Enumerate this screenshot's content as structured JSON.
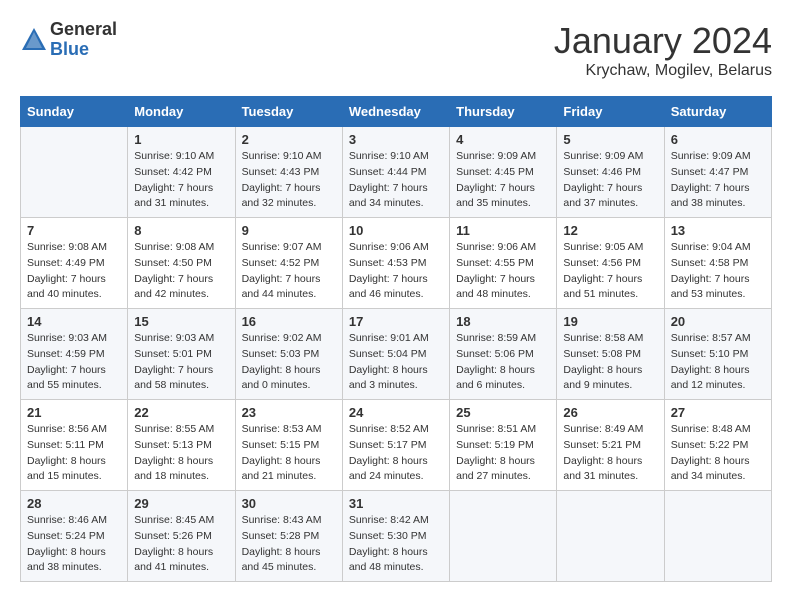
{
  "header": {
    "logo_general": "General",
    "logo_blue": "Blue",
    "title": "January 2024",
    "subtitle": "Krychaw, Mogilev, Belarus"
  },
  "calendar": {
    "days_of_week": [
      "Sunday",
      "Monday",
      "Tuesday",
      "Wednesday",
      "Thursday",
      "Friday",
      "Saturday"
    ],
    "weeks": [
      [
        {
          "day": "",
          "info": ""
        },
        {
          "day": "1",
          "info": "Sunrise: 9:10 AM\nSunset: 4:42 PM\nDaylight: 7 hours\nand 31 minutes."
        },
        {
          "day": "2",
          "info": "Sunrise: 9:10 AM\nSunset: 4:43 PM\nDaylight: 7 hours\nand 32 minutes."
        },
        {
          "day": "3",
          "info": "Sunrise: 9:10 AM\nSunset: 4:44 PM\nDaylight: 7 hours\nand 34 minutes."
        },
        {
          "day": "4",
          "info": "Sunrise: 9:09 AM\nSunset: 4:45 PM\nDaylight: 7 hours\nand 35 minutes."
        },
        {
          "day": "5",
          "info": "Sunrise: 9:09 AM\nSunset: 4:46 PM\nDaylight: 7 hours\nand 37 minutes."
        },
        {
          "day": "6",
          "info": "Sunrise: 9:09 AM\nSunset: 4:47 PM\nDaylight: 7 hours\nand 38 minutes."
        }
      ],
      [
        {
          "day": "7",
          "info": "Sunrise: 9:08 AM\nSunset: 4:49 PM\nDaylight: 7 hours\nand 40 minutes."
        },
        {
          "day": "8",
          "info": "Sunrise: 9:08 AM\nSunset: 4:50 PM\nDaylight: 7 hours\nand 42 minutes."
        },
        {
          "day": "9",
          "info": "Sunrise: 9:07 AM\nSunset: 4:52 PM\nDaylight: 7 hours\nand 44 minutes."
        },
        {
          "day": "10",
          "info": "Sunrise: 9:06 AM\nSunset: 4:53 PM\nDaylight: 7 hours\nand 46 minutes."
        },
        {
          "day": "11",
          "info": "Sunrise: 9:06 AM\nSunset: 4:55 PM\nDaylight: 7 hours\nand 48 minutes."
        },
        {
          "day": "12",
          "info": "Sunrise: 9:05 AM\nSunset: 4:56 PM\nDaylight: 7 hours\nand 51 minutes."
        },
        {
          "day": "13",
          "info": "Sunrise: 9:04 AM\nSunset: 4:58 PM\nDaylight: 7 hours\nand 53 minutes."
        }
      ],
      [
        {
          "day": "14",
          "info": "Sunrise: 9:03 AM\nSunset: 4:59 PM\nDaylight: 7 hours\nand 55 minutes."
        },
        {
          "day": "15",
          "info": "Sunrise: 9:03 AM\nSunset: 5:01 PM\nDaylight: 7 hours\nand 58 minutes."
        },
        {
          "day": "16",
          "info": "Sunrise: 9:02 AM\nSunset: 5:03 PM\nDaylight: 8 hours\nand 0 minutes."
        },
        {
          "day": "17",
          "info": "Sunrise: 9:01 AM\nSunset: 5:04 PM\nDaylight: 8 hours\nand 3 minutes."
        },
        {
          "day": "18",
          "info": "Sunrise: 8:59 AM\nSunset: 5:06 PM\nDaylight: 8 hours\nand 6 minutes."
        },
        {
          "day": "19",
          "info": "Sunrise: 8:58 AM\nSunset: 5:08 PM\nDaylight: 8 hours\nand 9 minutes."
        },
        {
          "day": "20",
          "info": "Sunrise: 8:57 AM\nSunset: 5:10 PM\nDaylight: 8 hours\nand 12 minutes."
        }
      ],
      [
        {
          "day": "21",
          "info": "Sunrise: 8:56 AM\nSunset: 5:11 PM\nDaylight: 8 hours\nand 15 minutes."
        },
        {
          "day": "22",
          "info": "Sunrise: 8:55 AM\nSunset: 5:13 PM\nDaylight: 8 hours\nand 18 minutes."
        },
        {
          "day": "23",
          "info": "Sunrise: 8:53 AM\nSunset: 5:15 PM\nDaylight: 8 hours\nand 21 minutes."
        },
        {
          "day": "24",
          "info": "Sunrise: 8:52 AM\nSunset: 5:17 PM\nDaylight: 8 hours\nand 24 minutes."
        },
        {
          "day": "25",
          "info": "Sunrise: 8:51 AM\nSunset: 5:19 PM\nDaylight: 8 hours\nand 27 minutes."
        },
        {
          "day": "26",
          "info": "Sunrise: 8:49 AM\nSunset: 5:21 PM\nDaylight: 8 hours\nand 31 minutes."
        },
        {
          "day": "27",
          "info": "Sunrise: 8:48 AM\nSunset: 5:22 PM\nDaylight: 8 hours\nand 34 minutes."
        }
      ],
      [
        {
          "day": "28",
          "info": "Sunrise: 8:46 AM\nSunset: 5:24 PM\nDaylight: 8 hours\nand 38 minutes."
        },
        {
          "day": "29",
          "info": "Sunrise: 8:45 AM\nSunset: 5:26 PM\nDaylight: 8 hours\nand 41 minutes."
        },
        {
          "day": "30",
          "info": "Sunrise: 8:43 AM\nSunset: 5:28 PM\nDaylight: 8 hours\nand 45 minutes."
        },
        {
          "day": "31",
          "info": "Sunrise: 8:42 AM\nSunset: 5:30 PM\nDaylight: 8 hours\nand 48 minutes."
        },
        {
          "day": "",
          "info": ""
        },
        {
          "day": "",
          "info": ""
        },
        {
          "day": "",
          "info": ""
        }
      ]
    ]
  }
}
